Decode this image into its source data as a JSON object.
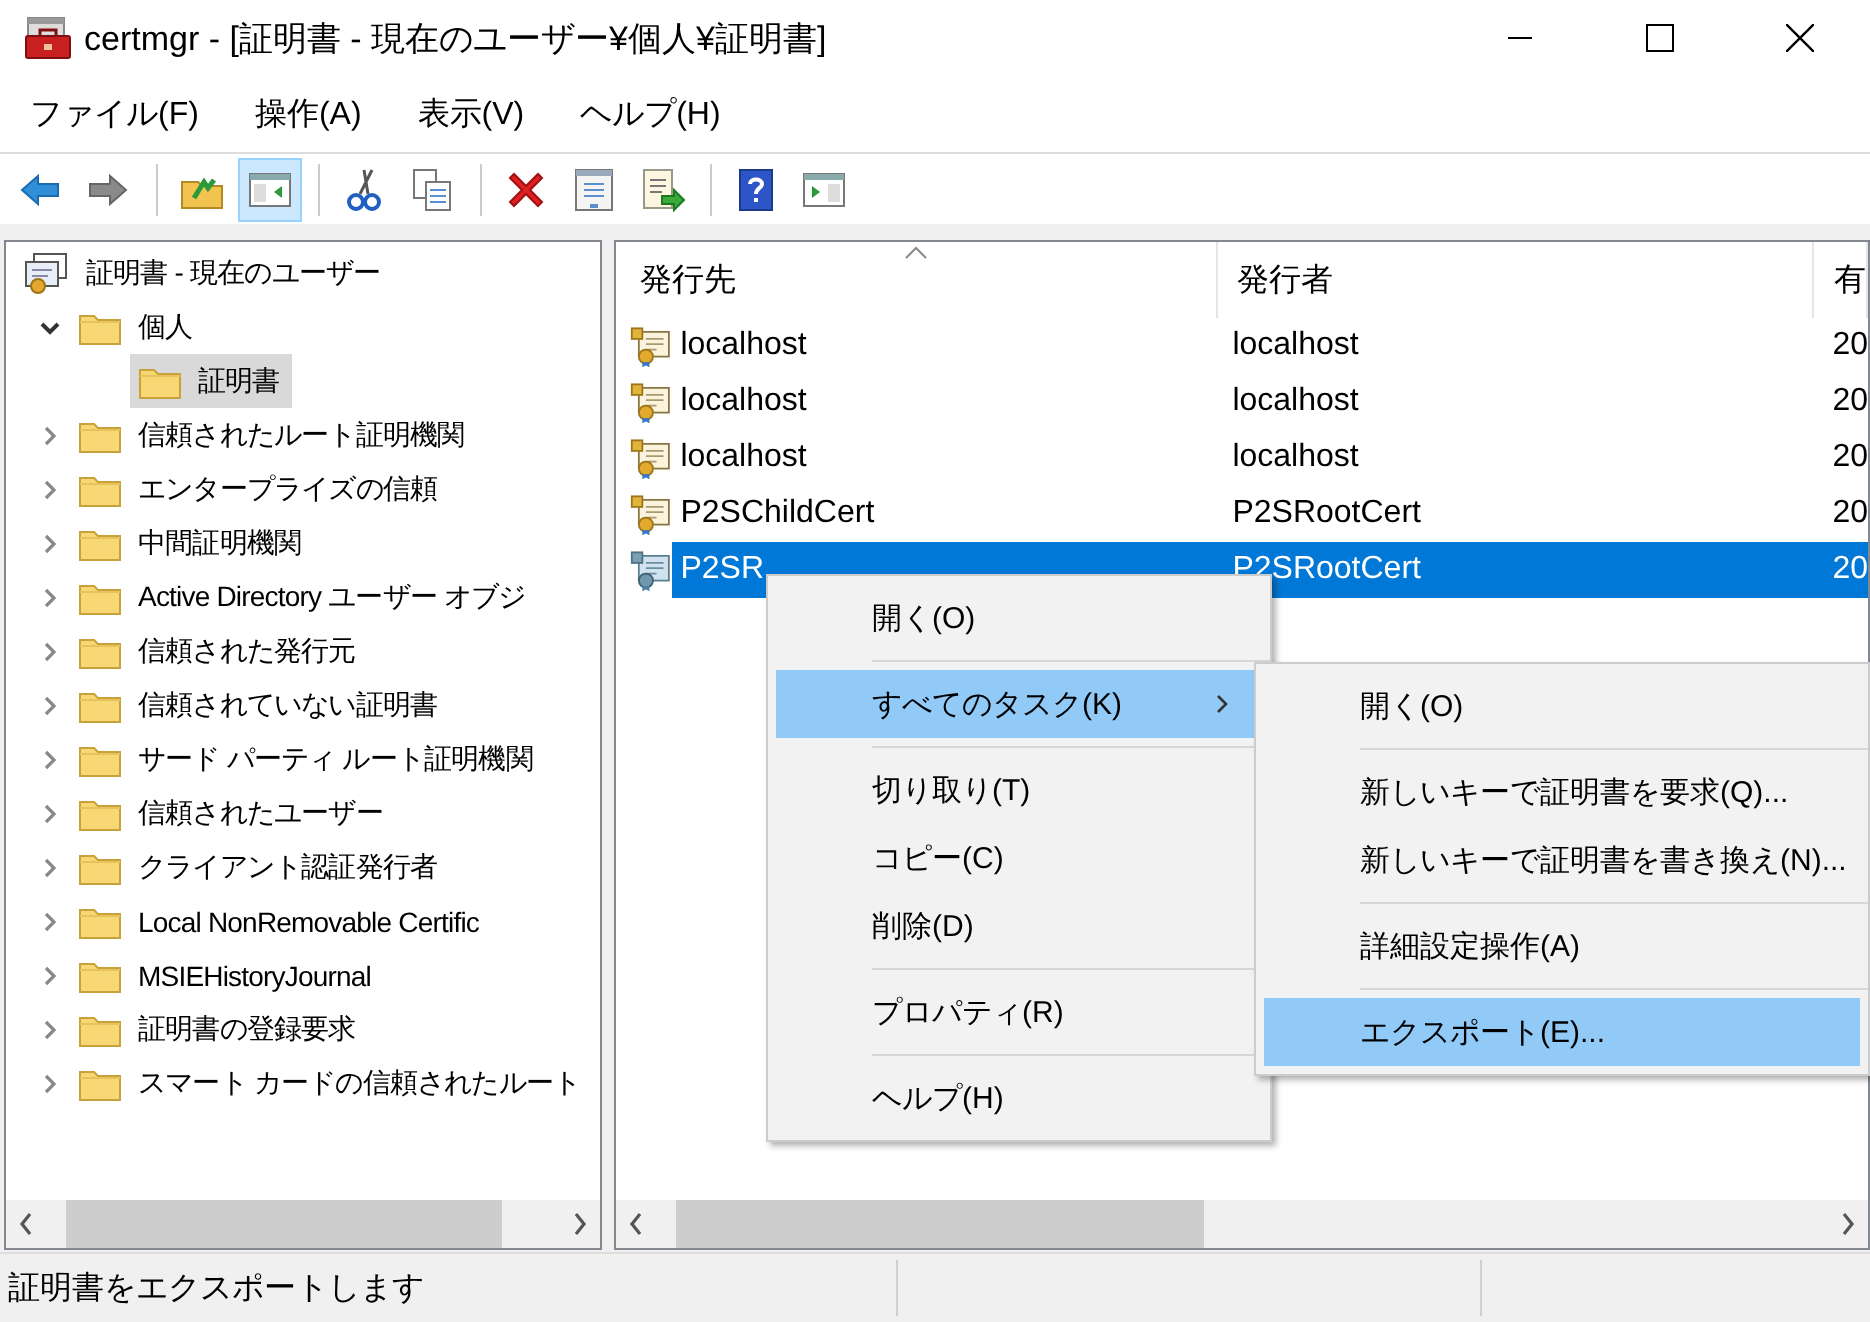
{
  "window": {
    "title": "certmgr - [証明書 - 現在のユーザー¥個人¥証明書]"
  },
  "menu_bar": [
    "ファイル(F)",
    "操作(A)",
    "表示(V)",
    "ヘルプ(H)"
  ],
  "toolbar": [
    {
      "kind": "back",
      "pressed": false
    },
    {
      "kind": "forward",
      "pressed": false
    },
    {
      "kind": "separator"
    },
    {
      "kind": "up",
      "pressed": false
    },
    {
      "kind": "tree-pane",
      "pressed": true
    },
    {
      "kind": "separator"
    },
    {
      "kind": "cut",
      "pressed": false
    },
    {
      "kind": "copy",
      "pressed": false
    },
    {
      "kind": "separator"
    },
    {
      "kind": "delete",
      "pressed": false
    },
    {
      "kind": "properties",
      "pressed": false
    },
    {
      "kind": "export",
      "pressed": false
    },
    {
      "kind": "separator"
    },
    {
      "kind": "help",
      "pressed": false
    },
    {
      "kind": "action-pane",
      "pressed": false
    }
  ],
  "tree": {
    "label": "証明書 - 現在のユーザー",
    "selected": false,
    "children": [
      {
        "label": "個人",
        "expanded": true,
        "selected": false,
        "children": [
          {
            "label": "証明書",
            "selected": true
          }
        ]
      },
      {
        "label": "信頼されたルート証明機関",
        "expanded": false,
        "selected": false
      },
      {
        "label": "エンタープライズの信頼",
        "expanded": false,
        "selected": false
      },
      {
        "label": "中間証明機関",
        "expanded": false,
        "selected": false
      },
      {
        "label": "Active Directory ユーザー オブジ",
        "expanded": false,
        "selected": false
      },
      {
        "label": "信頼された発行元",
        "expanded": false,
        "selected": false
      },
      {
        "label": "信頼されていない証明書",
        "expanded": false,
        "selected": false
      },
      {
        "label": "サード パーティ ルート証明機関",
        "expanded": false,
        "selected": false
      },
      {
        "label": "信頼されたユーザー",
        "expanded": false,
        "selected": false
      },
      {
        "label": "クライアント認証発行者",
        "expanded": false,
        "selected": false
      },
      {
        "label": "Local NonRemovable Certific",
        "expanded": false,
        "selected": false
      },
      {
        "label": "MSIEHistoryJournal",
        "expanded": false,
        "selected": false
      },
      {
        "label": "証明書の登録要求",
        "expanded": false,
        "selected": false
      },
      {
        "label": "スマート カードの信頼されたルート",
        "expanded": false,
        "selected": false
      }
    ]
  },
  "list": {
    "columns": [
      {
        "label": "発行先",
        "sorted": true
      },
      {
        "label": "発行者",
        "sorted": false
      },
      {
        "label": "有",
        "sorted": false
      }
    ],
    "rows": [
      {
        "cells": [
          "localhost",
          "localhost",
          "20"
        ],
        "selected": false
      },
      {
        "cells": [
          "localhost",
          "localhost",
          "20"
        ],
        "selected": false
      },
      {
        "cells": [
          "localhost",
          "localhost",
          "20"
        ],
        "selected": false
      },
      {
        "cells": [
          "P2SChildCert",
          "P2SRootCert",
          "20"
        ],
        "selected": false
      },
      {
        "cells": [
          "P2SR",
          "P2SRootCert",
          "20"
        ],
        "selected": true
      }
    ]
  },
  "context_menu": {
    "items": [
      {
        "kind": "item",
        "label": "開く(O)",
        "selected": false
      },
      {
        "kind": "separator"
      },
      {
        "kind": "submenu",
        "label": "すべてのタスク(K)",
        "selected": true
      },
      {
        "kind": "separator"
      },
      {
        "kind": "item",
        "label": "切り取り(T)",
        "selected": false
      },
      {
        "kind": "item",
        "label": "コピー(C)",
        "selected": false
      },
      {
        "kind": "item",
        "label": "削除(D)",
        "selected": false
      },
      {
        "kind": "separator"
      },
      {
        "kind": "item",
        "label": "プロパティ(R)",
        "selected": false
      },
      {
        "kind": "separator"
      },
      {
        "kind": "item",
        "label": "ヘルプ(H)",
        "selected": false
      }
    ]
  },
  "submenu": {
    "items": [
      {
        "kind": "item",
        "label": "開く(O)",
        "selected": false
      },
      {
        "kind": "separator"
      },
      {
        "kind": "item",
        "label": "新しいキーで証明書を要求(Q)...",
        "selected": false
      },
      {
        "kind": "item",
        "label": "新しいキーで証明書を書き換え(N)...",
        "selected": false
      },
      {
        "kind": "separator"
      },
      {
        "kind": "item",
        "label": "詳細設定操作(A)",
        "selected": false
      },
      {
        "kind": "separator"
      },
      {
        "kind": "item",
        "label": "エクスポート(E)...",
        "selected": true
      }
    ]
  },
  "status_bar": {
    "text": "証明書をエクスポートします"
  }
}
